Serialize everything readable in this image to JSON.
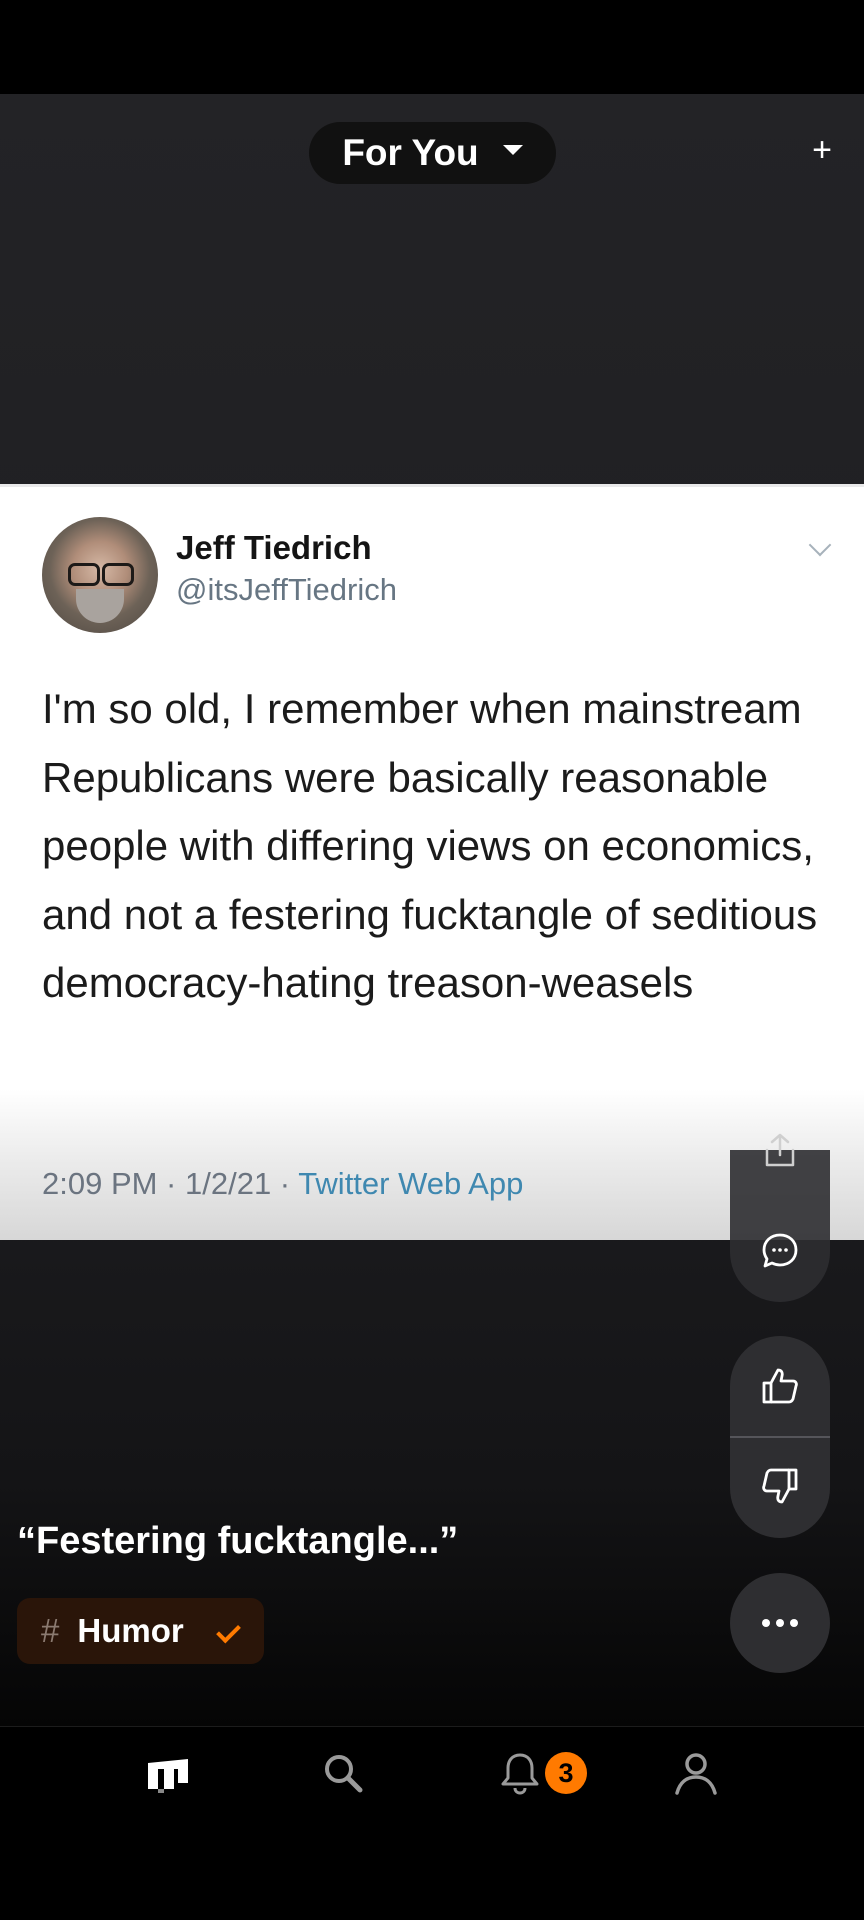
{
  "header": {
    "feed_selector_label": "For You",
    "add_label": "+"
  },
  "tweet": {
    "name": "Jeff Tiedrich",
    "handle": "@itsJeffTiedrich",
    "text": "I'm so old, I remember when mainstream Republicans were basically reasonable people with differing views on economics, and not a festering fucktangle of seditious democracy-hating treason-weasels",
    "meta_time": "2:09 PM · 1/2/21 · ",
    "meta_source": "Twitter Web App"
  },
  "post": {
    "caption": "“Festering fucktangle...”",
    "tag_hash": "#",
    "tag_label": "Humor"
  },
  "bottom_nav": {
    "notification_count": "3"
  },
  "colors": {
    "accent": "#ff7a00",
    "background": "#1d1d20"
  }
}
